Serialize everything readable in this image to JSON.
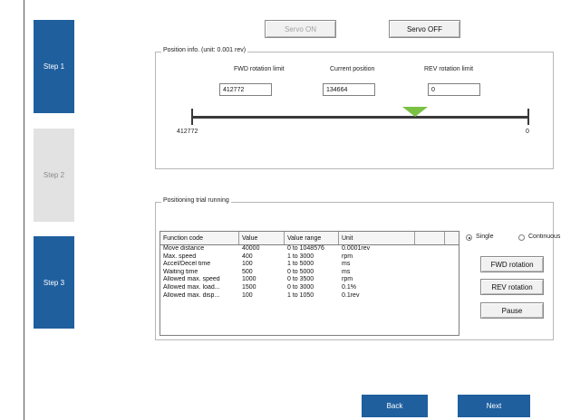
{
  "steps": [
    {
      "label": "Step 1",
      "state": "active"
    },
    {
      "label": "Step 2",
      "state": "inactive"
    },
    {
      "label": "Step 3",
      "state": "active"
    }
  ],
  "servo": {
    "on_label": "Servo ON",
    "off_label": "Servo OFF"
  },
  "position_info": {
    "title": "Position info. (unit: 0.001 rev)",
    "fwd_label": "FWD rotation limit",
    "current_label": "Current position",
    "rev_label": "REV rotation limit",
    "fwd_value": "412772",
    "current_value": "134664",
    "rev_value": "0",
    "scale_left": "412772",
    "scale_right": "0"
  },
  "trial": {
    "title": "Positioning trial running",
    "columns": [
      "Function code",
      "Value",
      "Value range",
      "Unit",
      ""
    ],
    "rows": [
      [
        "Move distance",
        "40000",
        "0 to 1048576",
        "0.0001rev"
      ],
      [
        "Max. speed",
        "400",
        "1 to 3000",
        "rpm"
      ],
      [
        "Accel/Decel time",
        "100",
        "1 to 5000",
        "ms"
      ],
      [
        "Waiting time",
        "500",
        "0 to 5000",
        "ms"
      ],
      [
        "Allowed max. speed",
        "1000",
        "0 to 3500",
        "rpm"
      ],
      [
        "Allowed max. load...",
        "1500",
        "0 to 3000",
        "0.1%"
      ],
      [
        "Allowed max. disp...",
        "100",
        "1 to 1050",
        "0.1rev"
      ]
    ],
    "mode_single": "Single",
    "mode_continuous": "Continuous",
    "fwd_button": "FWD rotation",
    "rev_button": "REV rotation",
    "pause_button": "Pause"
  },
  "nav": {
    "back": "Back",
    "next": "Next"
  }
}
